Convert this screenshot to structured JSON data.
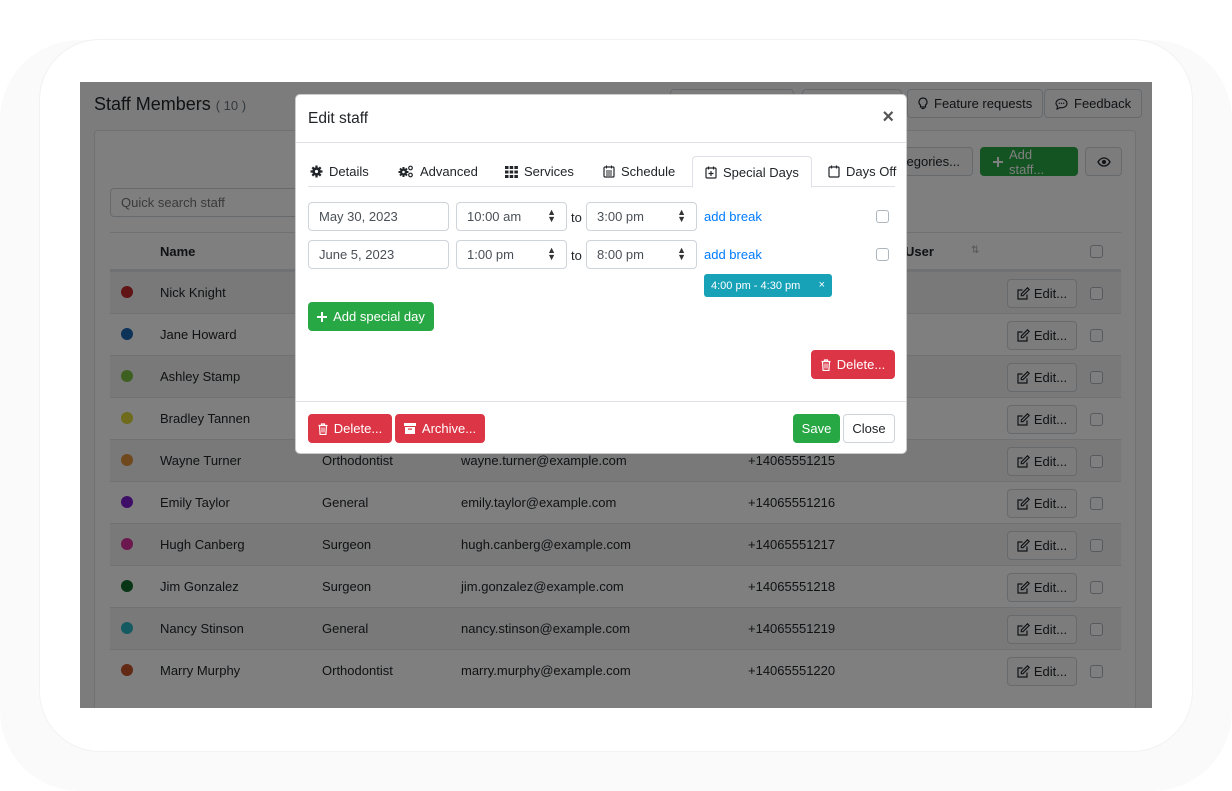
{
  "page": {
    "title": "Staff Members",
    "count": "( 10 )"
  },
  "top_buttons": {
    "feature_requests": "Feature requests",
    "feedback": "Feedback"
  },
  "toolbar": {
    "search_placeholder": "Quick search staff",
    "categories_label": "tegories...",
    "add_staff_label": "Add staff..."
  },
  "table": {
    "headers": {
      "name": "Name",
      "user": "User"
    },
    "edit_label": "Edit...",
    "rows": [
      {
        "name": "Nick Knight",
        "category": "",
        "email": "",
        "phone": "",
        "color": "#c0282d"
      },
      {
        "name": "Jane Howard",
        "category": "",
        "email": "",
        "phone": "",
        "color": "#1b66b3"
      },
      {
        "name": "Ashley Stamp",
        "category": "",
        "email": "",
        "phone": "",
        "color": "#7ac143"
      },
      {
        "name": "Bradley Tannen",
        "category": "",
        "email": "",
        "phone": "",
        "color": "#dcd63b"
      },
      {
        "name": "Wayne Turner",
        "category": "Orthodontist",
        "email": "wayne.turner@example.com",
        "phone": "+14065551215",
        "color": "#e0913a"
      },
      {
        "name": "Emily Taylor",
        "category": "General",
        "email": "emily.taylor@example.com",
        "phone": "+14065551216",
        "color": "#7e1fd1"
      },
      {
        "name": "Hugh Canberg",
        "category": "Surgeon",
        "email": "hugh.canberg@example.com",
        "phone": "+14065551217",
        "color": "#d9309e"
      },
      {
        "name": "Jim Gonzalez",
        "category": "Surgeon",
        "email": "jim.gonzalez@example.com",
        "phone": "+14065551218",
        "color": "#116a2a"
      },
      {
        "name": "Nancy Stinson",
        "category": "General",
        "email": "nancy.stinson@example.com",
        "phone": "+14065551219",
        "color": "#2bb4c2"
      },
      {
        "name": "Marry Murphy",
        "category": "Orthodontist",
        "email": "marry.murphy@example.com",
        "phone": "+14065551220",
        "color": "#c5522b"
      }
    ]
  },
  "modal": {
    "title": "Edit staff",
    "close_symbol": "×",
    "tabs": [
      {
        "label": "Details",
        "icon": "gear-icon"
      },
      {
        "label": "Advanced",
        "icon": "gears-icon"
      },
      {
        "label": "Services",
        "icon": "grid-icon"
      },
      {
        "label": "Schedule",
        "icon": "calendar-list-icon"
      },
      {
        "label": "Special Days",
        "icon": "calendar-plus-icon",
        "active": true
      },
      {
        "label": "Days Off",
        "icon": "calendar-icon"
      }
    ],
    "special_days": [
      {
        "date": "May 30, 2023",
        "start": "10:00 am",
        "end": "3:00 pm",
        "breaks": []
      },
      {
        "date": "June 5, 2023",
        "start": "1:00 pm",
        "end": "8:00 pm",
        "breaks": [
          "4:00 pm - 4:30 pm"
        ]
      }
    ],
    "to_label": "to",
    "add_break_label": "add break",
    "break_remove_symbol": "×",
    "add_special_day_label": "Add special day",
    "delete_selected_label": "Delete...",
    "footer": {
      "delete_label": "Delete...",
      "archive_label": "Archive...",
      "save_label": "Save",
      "close_label": "Close"
    }
  },
  "colors": {
    "primary": "#007bff",
    "success": "#28a745",
    "danger": "#dc3545",
    "info": "#17a2b8"
  }
}
